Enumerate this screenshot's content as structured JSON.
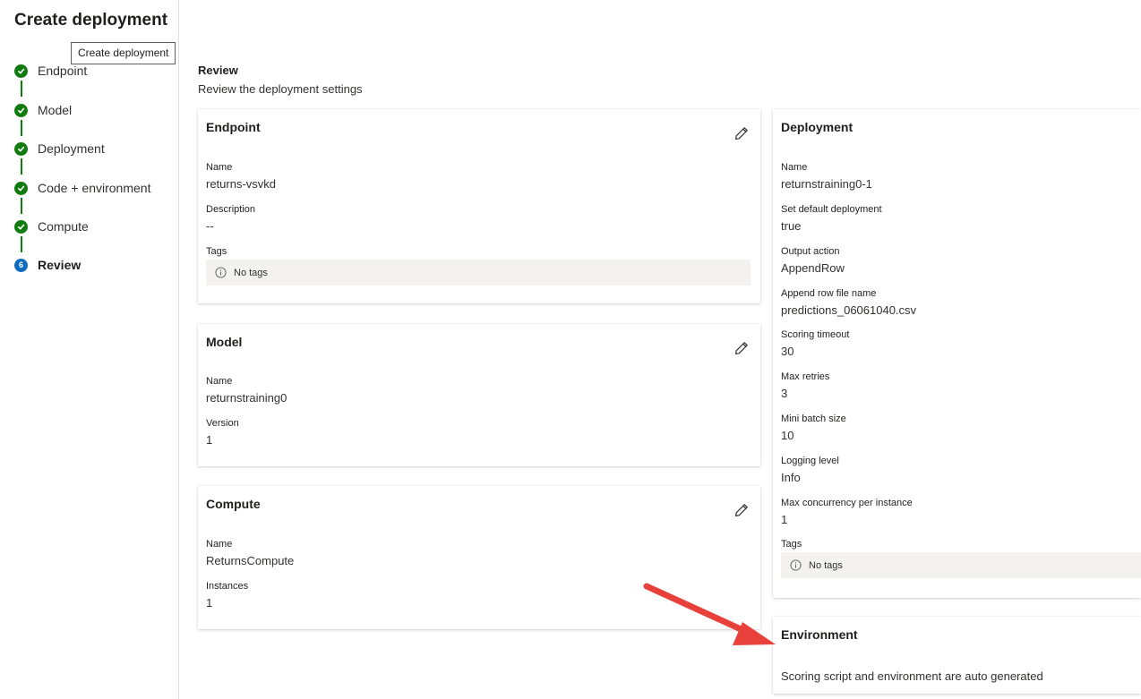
{
  "page": {
    "title": "Create deployment",
    "tooltip": "Create deployment"
  },
  "steps": [
    {
      "label": "Endpoint",
      "status": "complete"
    },
    {
      "label": "Model",
      "status": "complete"
    },
    {
      "label": "Deployment",
      "status": "complete"
    },
    {
      "label": "Code + environment",
      "status": "complete"
    },
    {
      "label": "Compute",
      "status": "complete"
    },
    {
      "label": "Review",
      "status": "current",
      "number": "6"
    }
  ],
  "review": {
    "title": "Review",
    "subtitle": "Review the deployment settings"
  },
  "endpoint_card": {
    "title": "Endpoint",
    "name_label": "Name",
    "name_value": "returns-vsvkd",
    "description_label": "Description",
    "description_value": "--",
    "tags_label": "Tags",
    "tags_value": "No tags"
  },
  "model_card": {
    "title": "Model",
    "name_label": "Name",
    "name_value": "returnstraining0",
    "version_label": "Version",
    "version_value": "1"
  },
  "compute_card": {
    "title": "Compute",
    "name_label": "Name",
    "name_value": "ReturnsCompute",
    "instances_label": "Instances",
    "instances_value": "1"
  },
  "deployment_card": {
    "title": "Deployment",
    "fields": [
      {
        "label": "Name",
        "value": "returnstraining0-1"
      },
      {
        "label": "Set default deployment",
        "value": "true"
      },
      {
        "label": "Output action",
        "value": "AppendRow"
      },
      {
        "label": "Append row file name",
        "value": "predictions_06061040.csv"
      },
      {
        "label": "Scoring timeout",
        "value": "30"
      },
      {
        "label": "Max retries",
        "value": "3"
      },
      {
        "label": "Mini batch size",
        "value": "10"
      },
      {
        "label": "Logging level",
        "value": "Info"
      },
      {
        "label": "Max concurrency per instance",
        "value": "1"
      }
    ],
    "tags_label": "Tags",
    "tags_value": "No tags"
  },
  "environment_card": {
    "title": "Environment",
    "text": "Scoring script and environment are auto generated"
  },
  "icons": {
    "step_complete": "check-circle-icon",
    "step_current": "step-number-icon",
    "edit": "pencil-icon",
    "info": "info-icon",
    "annotation": "red-arrow"
  },
  "colors": {
    "complete": "#107c10",
    "current": "#0f6cbd",
    "arrow": "#e8413b",
    "tagbox": "#f3f2f1"
  }
}
